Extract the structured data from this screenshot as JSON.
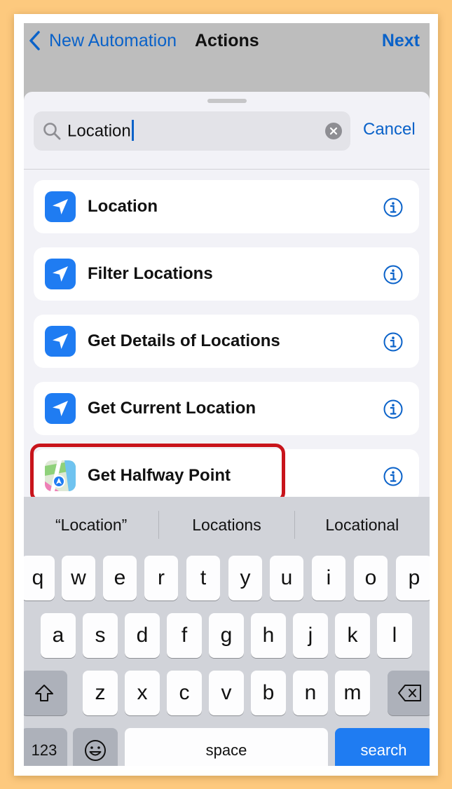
{
  "nav": {
    "back_label": "New Automation",
    "title": "Actions",
    "next_label": "Next"
  },
  "search": {
    "value": "Location",
    "cancel_label": "Cancel"
  },
  "results": [
    {
      "label": "Location",
      "icon": "location-arrow-icon"
    },
    {
      "label": "Filter Locations",
      "icon": "location-arrow-icon"
    },
    {
      "label": "Get Details of Locations",
      "icon": "location-arrow-icon"
    },
    {
      "label": "Get Current Location",
      "icon": "location-arrow-icon",
      "highlighted": true
    },
    {
      "label": "Get Halfway Point",
      "icon": "maps-app-icon"
    }
  ],
  "keyboard": {
    "suggestions": [
      "“Location”",
      "Locations",
      "Locational"
    ],
    "row1": [
      "q",
      "w",
      "e",
      "r",
      "t",
      "y",
      "u",
      "i",
      "o",
      "p"
    ],
    "row2": [
      "a",
      "s",
      "d",
      "f",
      "g",
      "h",
      "j",
      "k",
      "l"
    ],
    "row3": [
      "z",
      "x",
      "c",
      "v",
      "b",
      "n",
      "m"
    ],
    "numbers_label": "123",
    "space_label": "space",
    "search_label": "search"
  },
  "colors": {
    "accent": "#0a62c9",
    "highlight": "#c8141b",
    "icon_blue": "#1f7cf2"
  }
}
